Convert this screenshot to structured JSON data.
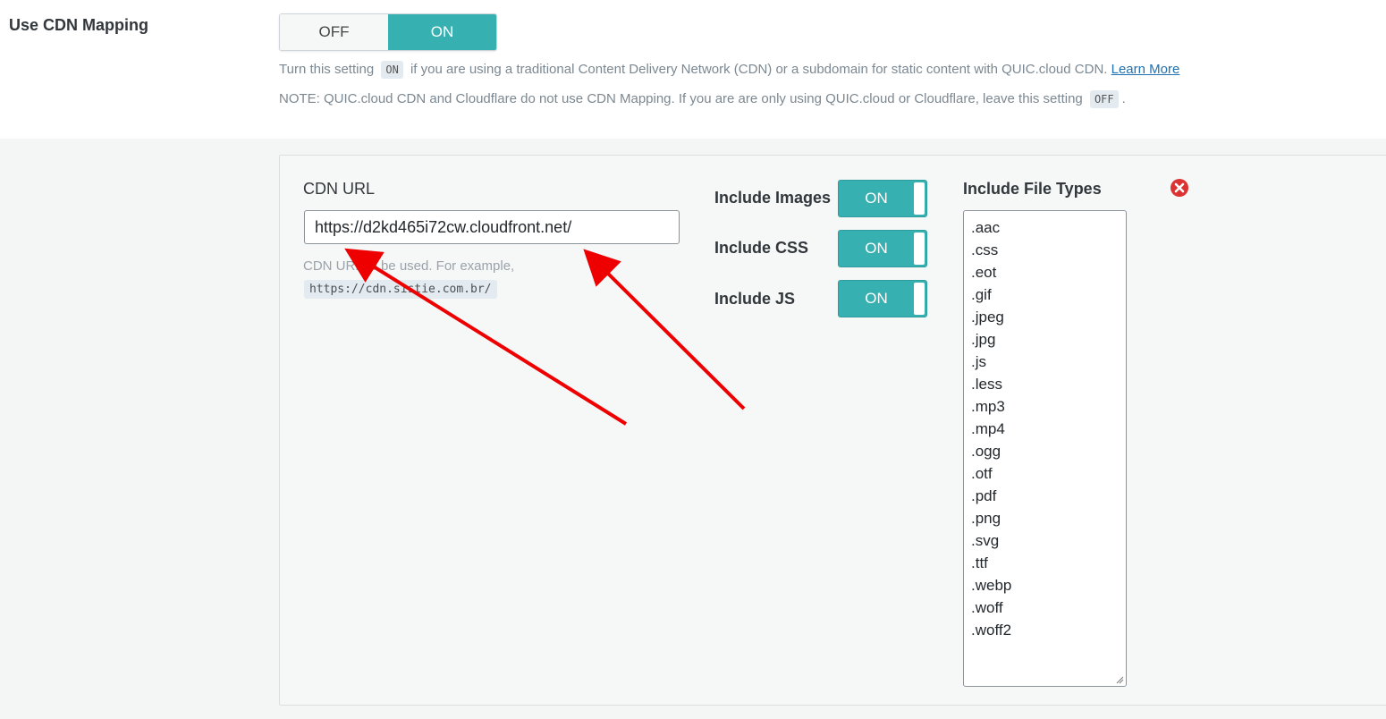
{
  "setting": {
    "title": "Use CDN Mapping",
    "toggle_off": "OFF",
    "toggle_on": "ON",
    "desc1_pre": "Turn this setting",
    "desc1_badge": "ON",
    "desc1_post": "if you are using a traditional Content Delivery Network (CDN) or a subdomain for static content with QUIC.cloud CDN.",
    "learn_more": "Learn More",
    "desc2_pre": "NOTE: QUIC.cloud CDN and Cloudflare do not use CDN Mapping. If you are are only using QUIC.cloud or Cloudflare, leave this setting",
    "desc2_badge": "OFF",
    "desc2_post": "."
  },
  "mapping": {
    "cdn_url_label": "CDN URL",
    "cdn_url_value": "https://d2kd465i72cw.cloudfront.net/",
    "cdn_url_hint": "CDN URL to be used. For example,",
    "cdn_url_example": "https://cdn.sistie.com.br/",
    "include_images_label": "Include Images",
    "include_images_state": "ON",
    "include_css_label": "Include CSS",
    "include_css_state": "ON",
    "include_js_label": "Include JS",
    "include_js_state": "ON",
    "file_types_label": "Include File Types",
    "file_types": [
      ".aac",
      ".css",
      ".eot",
      ".gif",
      ".jpeg",
      ".jpg",
      ".js",
      ".less",
      ".mp3",
      ".mp4",
      ".ogg",
      ".otf",
      ".pdf",
      ".png",
      ".svg",
      ".ttf",
      ".webp",
      ".woff",
      ".woff2"
    ],
    "remove_icon": "remove-circle-icon"
  },
  "colors": {
    "accent": "#36b0b0",
    "remove": "#dc3232",
    "annotation_arrow": "#ee0000"
  }
}
